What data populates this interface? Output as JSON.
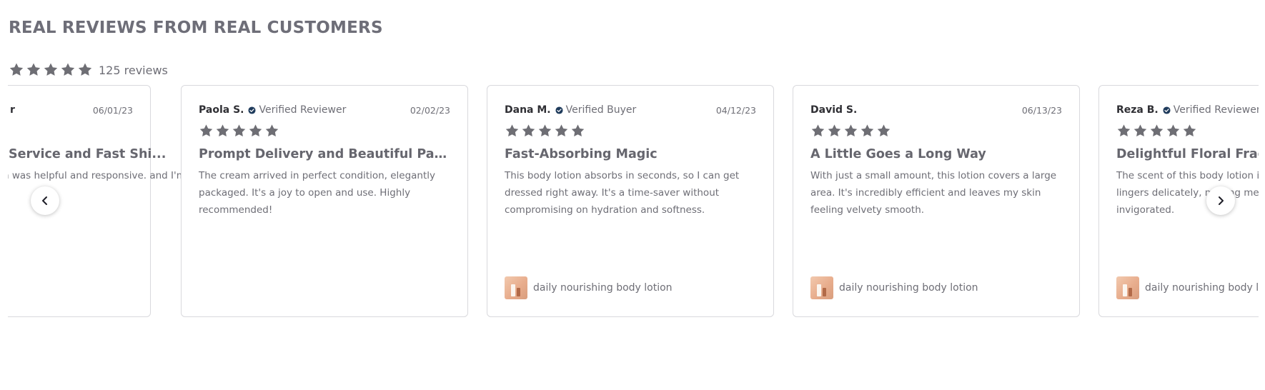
{
  "section": {
    "title": "REAL REVIEWS FROM REAL CUSTOMERS",
    "rating_stars": 5,
    "review_count": "125 reviews"
  },
  "colors": {
    "star": "#6e6e74",
    "verified_badge": "#1f3b5c",
    "border": "#d9d9dd"
  },
  "reviews": [
    {
      "reviewer": "r",
      "verified": "",
      "date": "06/01/23",
      "stars": 5,
      "title": "Service and Fast Shi...",
      "body": "n was helpful and responsive. and I'm thrilled with the",
      "product": ""
    },
    {
      "reviewer": "Paola S.",
      "verified": "Verified Reviewer",
      "date": "02/02/23",
      "stars": 5,
      "title": "Prompt Delivery and Beautiful Packaging",
      "body": "The cream arrived in perfect condition, elegantly packaged. It's a joy to open and use. Highly recommended!",
      "product": ""
    },
    {
      "reviewer": "Dana M.",
      "verified": "Verified Buyer",
      "date": "04/12/23",
      "stars": 5,
      "title": "Fast-Absorbing Magic",
      "body": "This body lotion absorbs in seconds, so I can get dressed right away. It's a time-saver without compromising on hydration and softness.",
      "product": "daily nourishing body lotion"
    },
    {
      "reviewer": "David S.",
      "verified": "",
      "date": "06/13/23",
      "stars": 5,
      "title": "A Little Goes a Long Way",
      "body": "With just a small amount, this lotion covers a large area. It's incredibly efficient and leaves my skin feeling velvety smooth.",
      "product": "daily nourishing body lotion"
    },
    {
      "reviewer": "Reza B.",
      "verified": "Verified Reviewer",
      "date": "",
      "stars": 5,
      "title": "Delightful Floral Fragrance",
      "body": "The scent of this body lotion is like fresh flowers. It lingers delicately, making me feel refreshed and invigorated.",
      "product": "daily nourishing body lotion"
    }
  ],
  "nav": {
    "prev_icon": "chevron-left-icon",
    "next_icon": "chevron-right-icon"
  }
}
